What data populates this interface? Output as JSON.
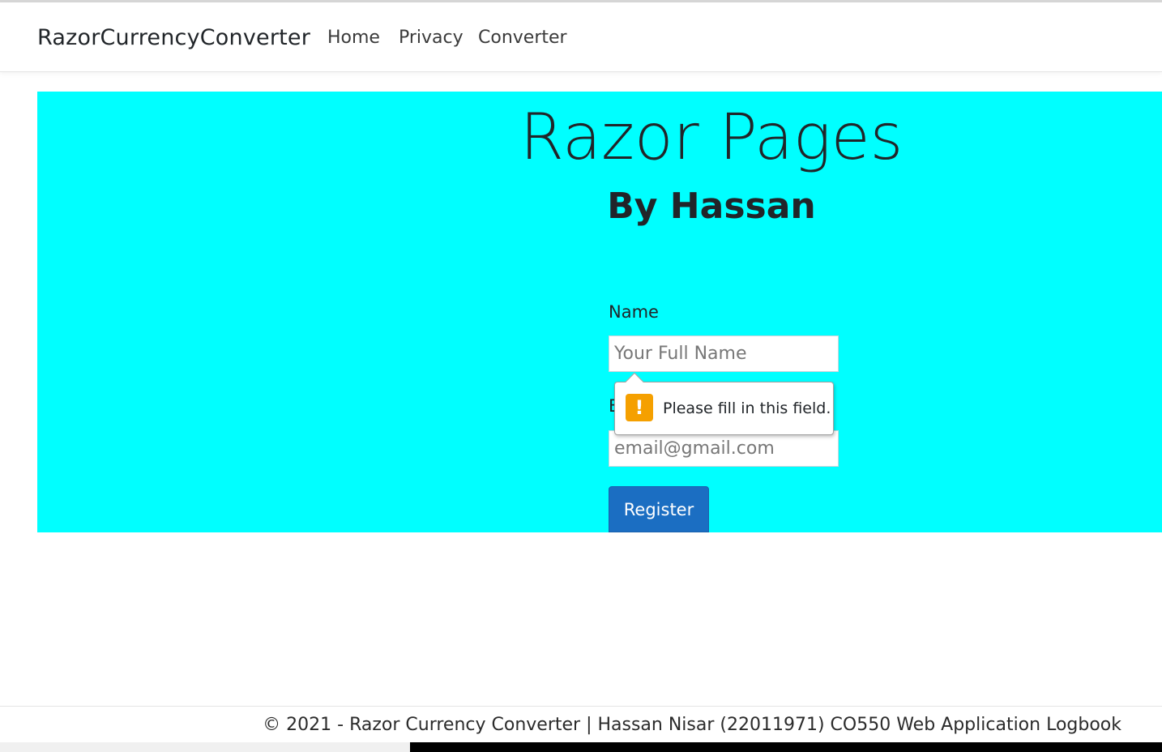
{
  "navbar": {
    "brand": "RazorCurrencyConverter",
    "links": [
      {
        "label": "Home"
      },
      {
        "label": "Privacy"
      },
      {
        "label": "Converter"
      }
    ]
  },
  "hero": {
    "title": "Razor Pages",
    "subtitle": "By Hassan",
    "background_color": "#00ffff"
  },
  "form": {
    "name_label": "Name",
    "name_placeholder": "Your Full Name",
    "email_label": "E",
    "email_placeholder": "email@gmail.com",
    "submit_label": "Register",
    "submit_color": "#1b6ec2"
  },
  "validation": {
    "icon": "warning-exclamation-icon",
    "icon_glyph": "!",
    "icon_color": "#f5a000",
    "message": "Please fill in this field."
  },
  "footer": {
    "text": "© 2021 - Razor Currency Converter | Hassan Nisar (22011971) CO550 Web Application Logbook"
  }
}
